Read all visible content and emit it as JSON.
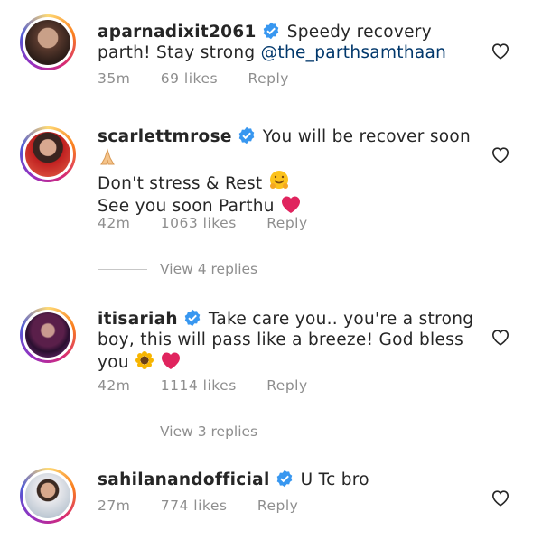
{
  "comments": [
    {
      "username": "aparnadixit2061",
      "text_before": "Speedy recovery parth! Stay strong ",
      "mention": "@the_parthsamthaan",
      "time": "35m",
      "likes": "69 likes",
      "reply": "Reply"
    },
    {
      "username": "scarlettmrose",
      "text": "You will be recover soon",
      "line2": "Don't stress & Rest",
      "line3": "See you soon Parthu",
      "time": "42m",
      "likes": "1063 likes",
      "reply": "Reply",
      "view_replies": "View 4 replies"
    },
    {
      "username": "itisariah",
      "text": "Take care you.. you're a strong boy, this will pass like a breeze! God bless you",
      "time": "42m",
      "likes": "1114 likes",
      "reply": "Reply",
      "view_replies": "View 3 replies"
    },
    {
      "username": "sahilanandofficial",
      "text": "U Tc bro",
      "time": "27m",
      "likes": "774 likes",
      "reply": "Reply"
    }
  ],
  "colors": {
    "verified": "#3897f0",
    "mention": "#00376b",
    "meta": "#8e8e8e",
    "heart_emoji": "#e0245e"
  },
  "icons": [
    "verified-badge-icon",
    "heart-outline-icon",
    "folded-hands-emoji",
    "hugging-face-emoji",
    "red-heart-emoji",
    "sunflower-emoji"
  ]
}
